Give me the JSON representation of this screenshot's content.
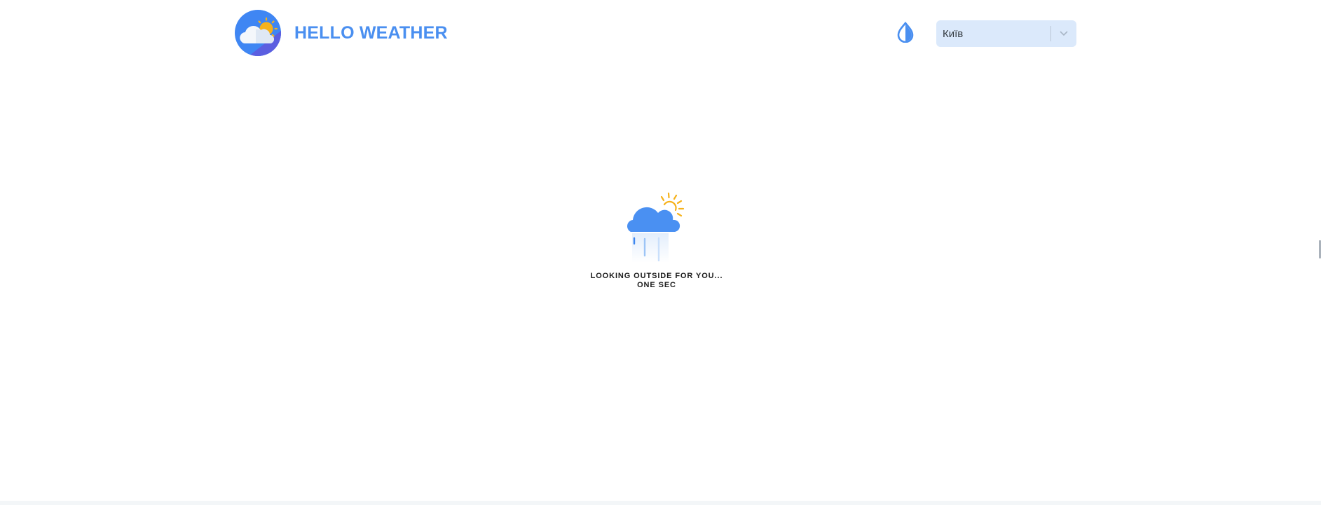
{
  "header": {
    "app_title": "HELLO WEATHER",
    "logo_icon": "cloud-sun-logo-icon",
    "theme_toggle_icon": "water-drop-icon",
    "city_select": {
      "value": "Київ",
      "arrow_icon": "chevron-down-icon"
    }
  },
  "loader": {
    "icon": "cloud-sun-rain-icon",
    "line1": "LOOKING OUTSIDE FOR YOU...",
    "line2": "ONE SEC"
  },
  "colors": {
    "accent": "#4a8ff0",
    "logo_blue": "#3f86f3",
    "logo_purple": "#5b5ee0",
    "sun": "#f6b21b",
    "select_bg": "#dbe9fb"
  }
}
